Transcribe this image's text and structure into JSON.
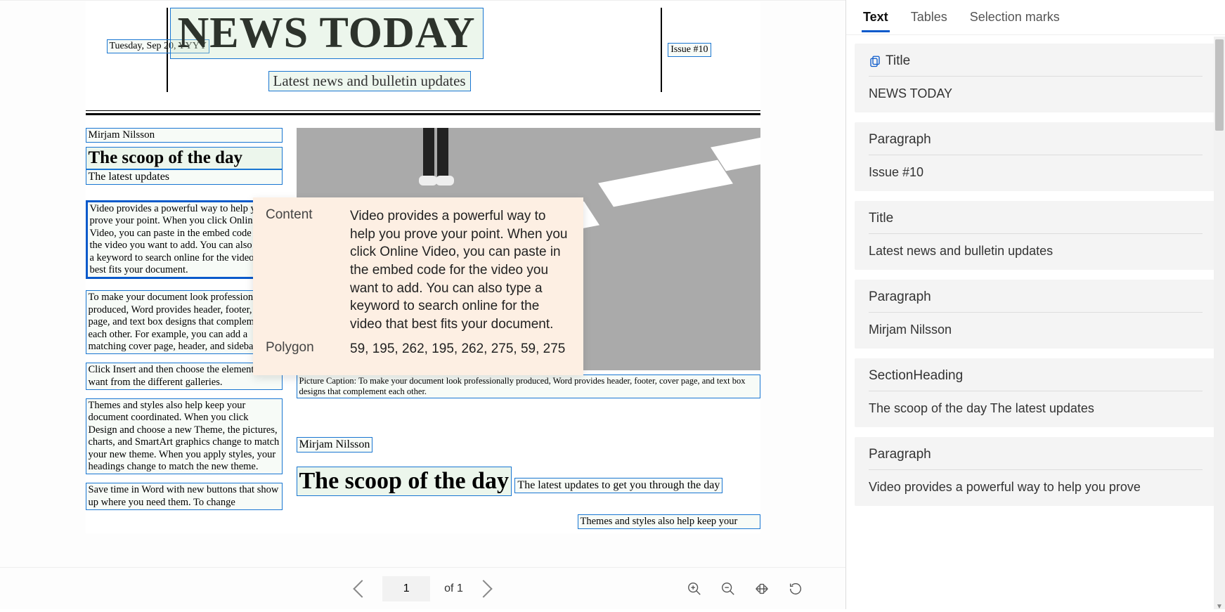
{
  "tabs": {
    "text": "Text",
    "tables": "Tables",
    "selection_marks": "Selection marks"
  },
  "doc": {
    "date": "Tuesday, Sep 20, YYYY",
    "title": "NEWS TODAY",
    "issue": "Issue #10",
    "subtitle": "Latest news and bulletin updates",
    "author": "Mirjam Nilsson",
    "headline": "The scoop of the day",
    "deck": "The latest updates",
    "p1": "Video provides a powerful way to help you prove your point. When you click Online Video, you can paste in the embed code for the video you want to add. You can also type a keyword to search online for the video that best fits your document.",
    "p2": "To make your document look professionally produced, Word provides header, footer, cover page, and text box designs that complement each other. For example, you can add a matching cover page, header, and sidebar.",
    "p3": "Click Insert and then choose the elements you want from the different galleries.",
    "p4": "Themes and styles also help keep your document coordinated. When you click Design and choose a new Theme, the pictures, charts, and SmartArt graphics change to match your new theme. When you apply styles, your headings change to match the new theme.",
    "p5": "Save time in Word with new buttons that show up where you need them. To change",
    "caption": "Picture Caption: To make your document look professionally produced, Word provides header, footer, cover page, and text box designs that complement each other.",
    "author2": "Mirjam Nilsson",
    "headline2": "The scoop of the day",
    "deck2": "The latest updates to get you through the day",
    "p6": "Themes and styles also help keep your"
  },
  "popover": {
    "content_label": "Content",
    "content_value": "Video provides a powerful way to help you prove your point. When you click Online Video, you can paste in the embed code for the video you want to add. You can also type a keyword to search online for the video that best fits your document.",
    "polygon_label": "Polygon",
    "polygon_value": "59, 195, 262, 195, 262, 275, 59, 275"
  },
  "pager": {
    "current": "1",
    "of_label": "of",
    "total": "1"
  },
  "cards": [
    {
      "label": "Title",
      "value": "NEWS TODAY",
      "icon": true
    },
    {
      "label": "Paragraph",
      "value": "Issue #10"
    },
    {
      "label": "Title",
      "value": "Latest news and bulletin updates"
    },
    {
      "label": "Paragraph",
      "value": "Mirjam Nilsson"
    },
    {
      "label": "SectionHeading",
      "value": "The scoop of the day The latest updates"
    },
    {
      "label": "Paragraph",
      "value": "Video provides a powerful way to help you prove"
    }
  ]
}
